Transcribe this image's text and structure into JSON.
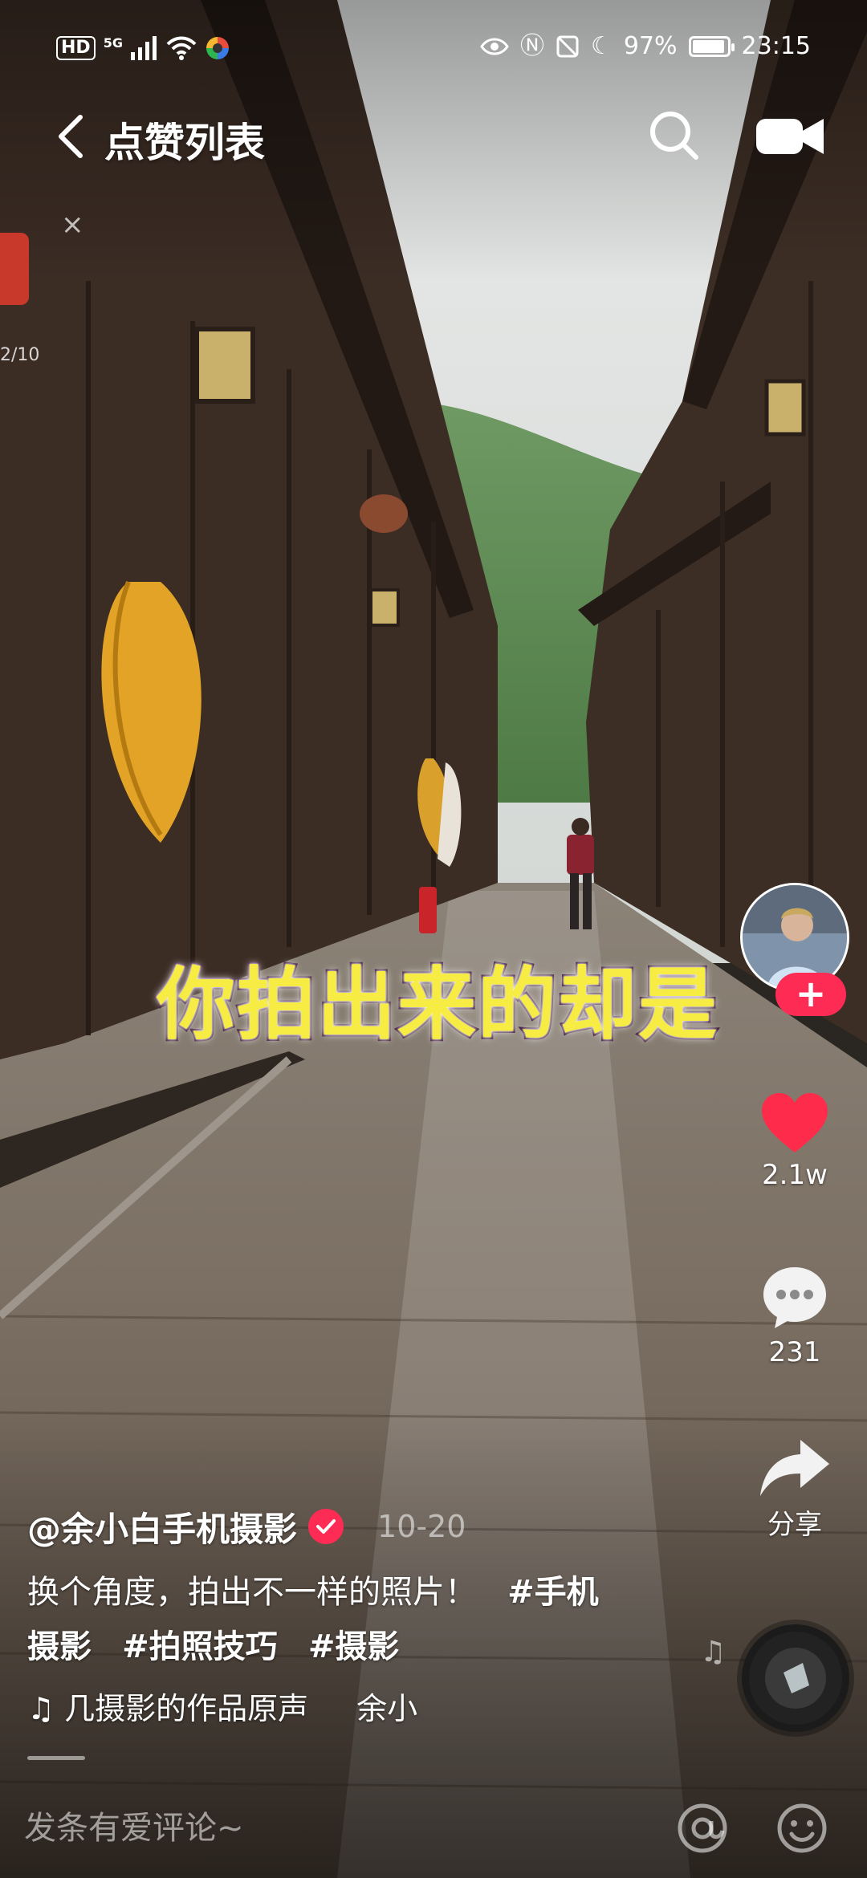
{
  "status_bar": {
    "hd_badge": "HD",
    "network": "5G",
    "battery_text": "97%",
    "battery_level": 0.97,
    "time": "23:15"
  },
  "nav": {
    "title": "点赞列表",
    "back_icon": "chevron-left-icon",
    "search_icon": "search-icon",
    "camera_icon": "video-camera-icon"
  },
  "float_widget": {
    "count": "2/10"
  },
  "video": {
    "overlay_caption": "你拍出来的却是"
  },
  "actions": {
    "follow_label": "+",
    "like_count": "2.1w",
    "comment_count": "231",
    "share_label": "分享"
  },
  "post": {
    "author": "@余小白手机摄影",
    "date": "10-20",
    "caption": "换个角度，拍出不一样的照片！",
    "hashtags": [
      "#手机",
      "摄影",
      "#拍照技巧",
      "#摄影"
    ],
    "music": "♫ 几摄影的作品原声",
    "music_author": "余小"
  },
  "comment_bar": {
    "placeholder": "发条有爱评论~"
  },
  "colors": {
    "accent": "#fe2c55",
    "caption_yellow": "#f6ec43",
    "like_red": "#fe2c4a"
  }
}
